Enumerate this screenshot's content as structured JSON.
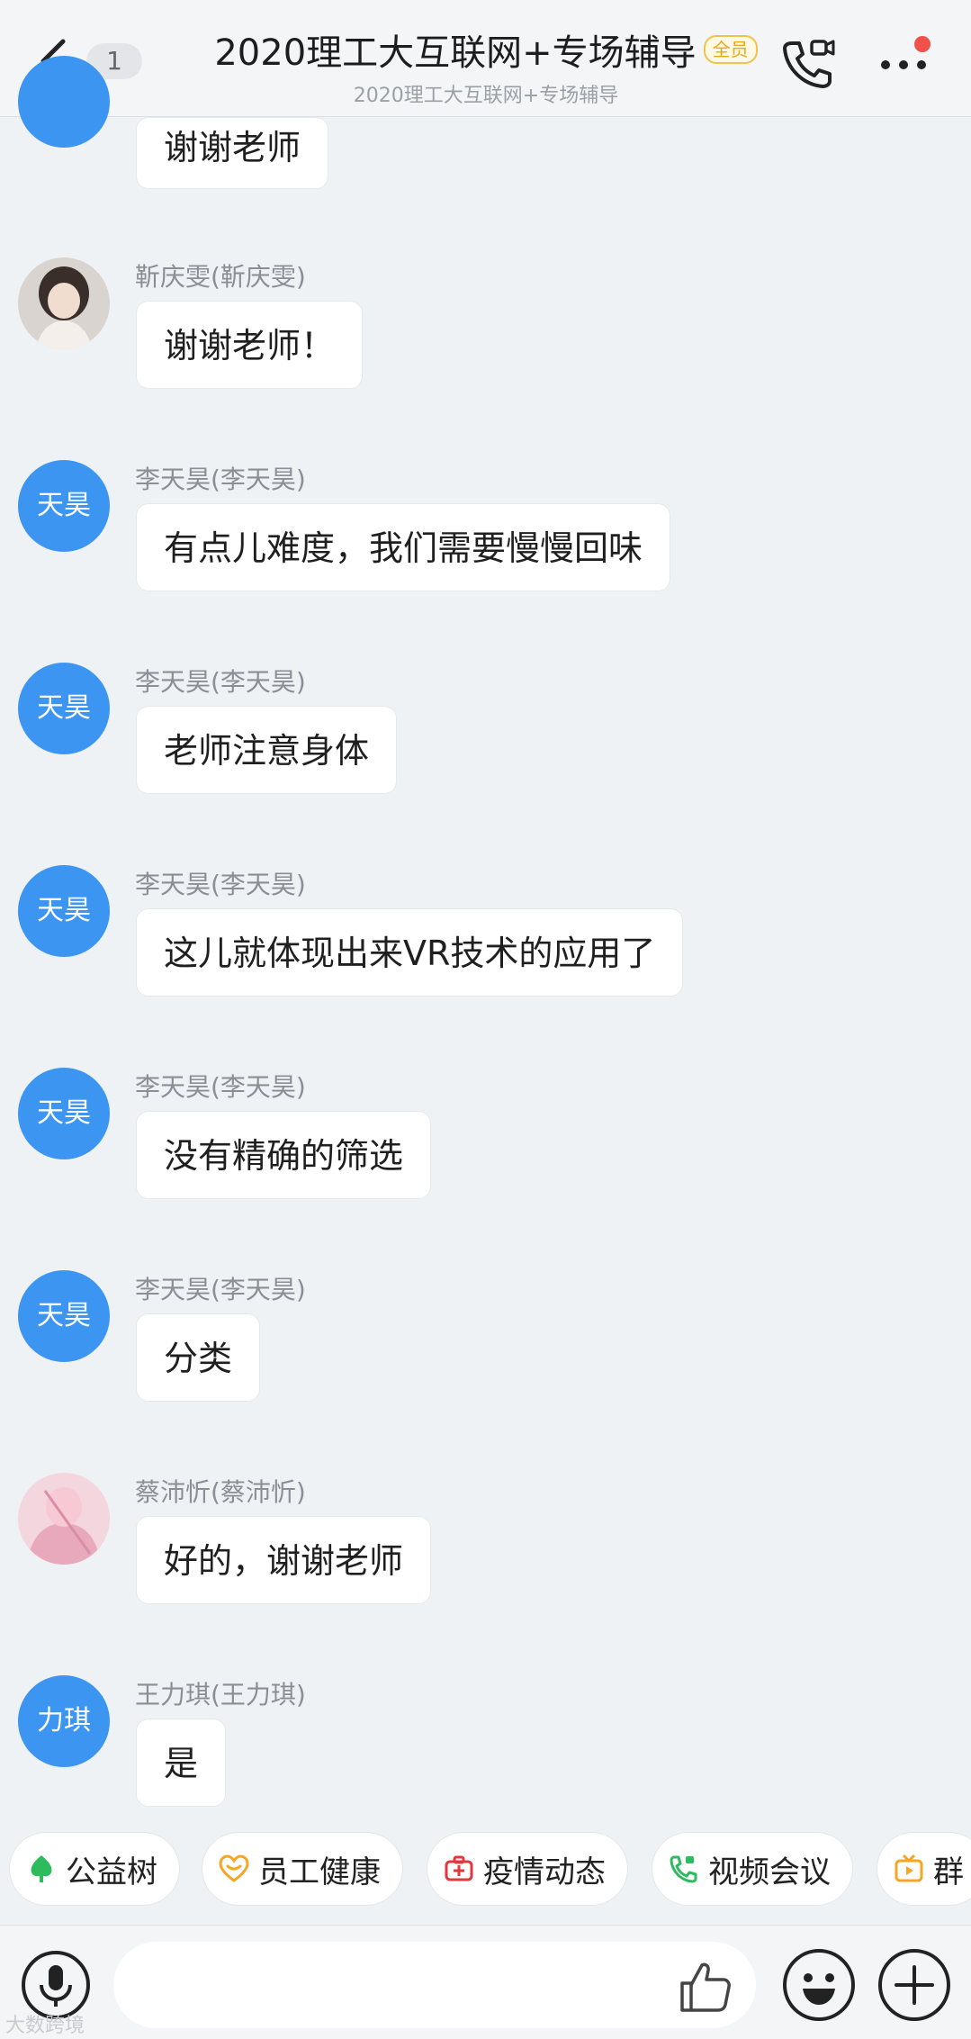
{
  "header": {
    "unread_count": "1",
    "title": "2020理工大互联网+专场辅导",
    "badge": "全员",
    "subtitle": "2020理工大互联网+专场辅导"
  },
  "messages": [
    {
      "sender": "",
      "avatar_text": "",
      "text": "谢谢老师"
    },
    {
      "sender": "靳庆雯(靳庆雯)",
      "avatar_text": "",
      "text": "谢谢老师！"
    },
    {
      "sender": "李天昊(李天昊)",
      "avatar_text": "天昊",
      "text": "有点儿难度，我们需要慢慢回味"
    },
    {
      "sender": "李天昊(李天昊)",
      "avatar_text": "天昊",
      "text": "老师注意身体"
    },
    {
      "sender": "李天昊(李天昊)",
      "avatar_text": "天昊",
      "text": "这儿就体现出来VR技术的应用了"
    },
    {
      "sender": "李天昊(李天昊)",
      "avatar_text": "天昊",
      "text": "没有精确的筛选"
    },
    {
      "sender": "李天昊(李天昊)",
      "avatar_text": "天昊",
      "text": "分类"
    },
    {
      "sender": "蔡沛忻(蔡沛忻)",
      "avatar_text": "",
      "text": "好的，谢谢老师"
    },
    {
      "sender": "王力琪(王力琪)",
      "avatar_text": "力琪",
      "text": "是"
    }
  ],
  "quick_apps": [
    {
      "label": "公益树",
      "icon": "tree-icon",
      "color": "#2dbb5d"
    },
    {
      "label": "员工健康",
      "icon": "heart-icon",
      "color": "#f5a623"
    },
    {
      "label": "疫情动态",
      "icon": "medkit-icon",
      "color": "#e0383e"
    },
    {
      "label": "视频会议",
      "icon": "video-call-icon",
      "color": "#2dbb5d"
    },
    {
      "label": "群",
      "icon": "tv-icon",
      "color": "#f5a623"
    }
  ],
  "input": {
    "placeholder": ""
  },
  "watermark": "大数跨境",
  "colors": {
    "avatar_blue": "#3d95f2",
    "badge_gold": "#e8a917",
    "notify_red": "#f0514a"
  }
}
